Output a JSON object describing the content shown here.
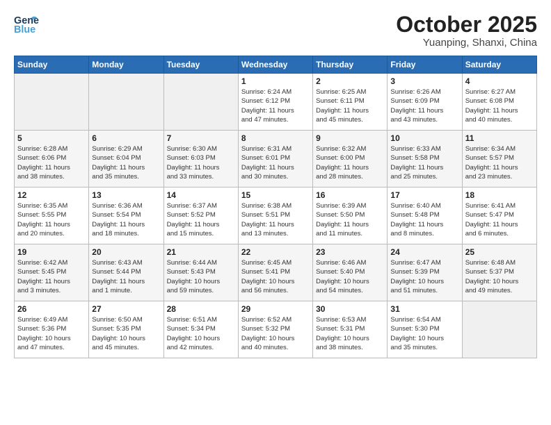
{
  "header": {
    "logo_line1": "General",
    "logo_line2": "Blue",
    "month": "October 2025",
    "location": "Yuanping, Shanxi, China"
  },
  "weekdays": [
    "Sunday",
    "Monday",
    "Tuesday",
    "Wednesday",
    "Thursday",
    "Friday",
    "Saturday"
  ],
  "weeks": [
    [
      {
        "day": "",
        "info": ""
      },
      {
        "day": "",
        "info": ""
      },
      {
        "day": "",
        "info": ""
      },
      {
        "day": "1",
        "info": "Sunrise: 6:24 AM\nSunset: 6:12 PM\nDaylight: 11 hours\nand 47 minutes."
      },
      {
        "day": "2",
        "info": "Sunrise: 6:25 AM\nSunset: 6:11 PM\nDaylight: 11 hours\nand 45 minutes."
      },
      {
        "day": "3",
        "info": "Sunrise: 6:26 AM\nSunset: 6:09 PM\nDaylight: 11 hours\nand 43 minutes."
      },
      {
        "day": "4",
        "info": "Sunrise: 6:27 AM\nSunset: 6:08 PM\nDaylight: 11 hours\nand 40 minutes."
      }
    ],
    [
      {
        "day": "5",
        "info": "Sunrise: 6:28 AM\nSunset: 6:06 PM\nDaylight: 11 hours\nand 38 minutes."
      },
      {
        "day": "6",
        "info": "Sunrise: 6:29 AM\nSunset: 6:04 PM\nDaylight: 11 hours\nand 35 minutes."
      },
      {
        "day": "7",
        "info": "Sunrise: 6:30 AM\nSunset: 6:03 PM\nDaylight: 11 hours\nand 33 minutes."
      },
      {
        "day": "8",
        "info": "Sunrise: 6:31 AM\nSunset: 6:01 PM\nDaylight: 11 hours\nand 30 minutes."
      },
      {
        "day": "9",
        "info": "Sunrise: 6:32 AM\nSunset: 6:00 PM\nDaylight: 11 hours\nand 28 minutes."
      },
      {
        "day": "10",
        "info": "Sunrise: 6:33 AM\nSunset: 5:58 PM\nDaylight: 11 hours\nand 25 minutes."
      },
      {
        "day": "11",
        "info": "Sunrise: 6:34 AM\nSunset: 5:57 PM\nDaylight: 11 hours\nand 23 minutes."
      }
    ],
    [
      {
        "day": "12",
        "info": "Sunrise: 6:35 AM\nSunset: 5:55 PM\nDaylight: 11 hours\nand 20 minutes."
      },
      {
        "day": "13",
        "info": "Sunrise: 6:36 AM\nSunset: 5:54 PM\nDaylight: 11 hours\nand 18 minutes."
      },
      {
        "day": "14",
        "info": "Sunrise: 6:37 AM\nSunset: 5:52 PM\nDaylight: 11 hours\nand 15 minutes."
      },
      {
        "day": "15",
        "info": "Sunrise: 6:38 AM\nSunset: 5:51 PM\nDaylight: 11 hours\nand 13 minutes."
      },
      {
        "day": "16",
        "info": "Sunrise: 6:39 AM\nSunset: 5:50 PM\nDaylight: 11 hours\nand 11 minutes."
      },
      {
        "day": "17",
        "info": "Sunrise: 6:40 AM\nSunset: 5:48 PM\nDaylight: 11 hours\nand 8 minutes."
      },
      {
        "day": "18",
        "info": "Sunrise: 6:41 AM\nSunset: 5:47 PM\nDaylight: 11 hours\nand 6 minutes."
      }
    ],
    [
      {
        "day": "19",
        "info": "Sunrise: 6:42 AM\nSunset: 5:45 PM\nDaylight: 11 hours\nand 3 minutes."
      },
      {
        "day": "20",
        "info": "Sunrise: 6:43 AM\nSunset: 5:44 PM\nDaylight: 11 hours\nand 1 minute."
      },
      {
        "day": "21",
        "info": "Sunrise: 6:44 AM\nSunset: 5:43 PM\nDaylight: 10 hours\nand 59 minutes."
      },
      {
        "day": "22",
        "info": "Sunrise: 6:45 AM\nSunset: 5:41 PM\nDaylight: 10 hours\nand 56 minutes."
      },
      {
        "day": "23",
        "info": "Sunrise: 6:46 AM\nSunset: 5:40 PM\nDaylight: 10 hours\nand 54 minutes."
      },
      {
        "day": "24",
        "info": "Sunrise: 6:47 AM\nSunset: 5:39 PM\nDaylight: 10 hours\nand 51 minutes."
      },
      {
        "day": "25",
        "info": "Sunrise: 6:48 AM\nSunset: 5:37 PM\nDaylight: 10 hours\nand 49 minutes."
      }
    ],
    [
      {
        "day": "26",
        "info": "Sunrise: 6:49 AM\nSunset: 5:36 PM\nDaylight: 10 hours\nand 47 minutes."
      },
      {
        "day": "27",
        "info": "Sunrise: 6:50 AM\nSunset: 5:35 PM\nDaylight: 10 hours\nand 45 minutes."
      },
      {
        "day": "28",
        "info": "Sunrise: 6:51 AM\nSunset: 5:34 PM\nDaylight: 10 hours\nand 42 minutes."
      },
      {
        "day": "29",
        "info": "Sunrise: 6:52 AM\nSunset: 5:32 PM\nDaylight: 10 hours\nand 40 minutes."
      },
      {
        "day": "30",
        "info": "Sunrise: 6:53 AM\nSunset: 5:31 PM\nDaylight: 10 hours\nand 38 minutes."
      },
      {
        "day": "31",
        "info": "Sunrise: 6:54 AM\nSunset: 5:30 PM\nDaylight: 10 hours\nand 35 minutes."
      },
      {
        "day": "",
        "info": ""
      }
    ]
  ]
}
